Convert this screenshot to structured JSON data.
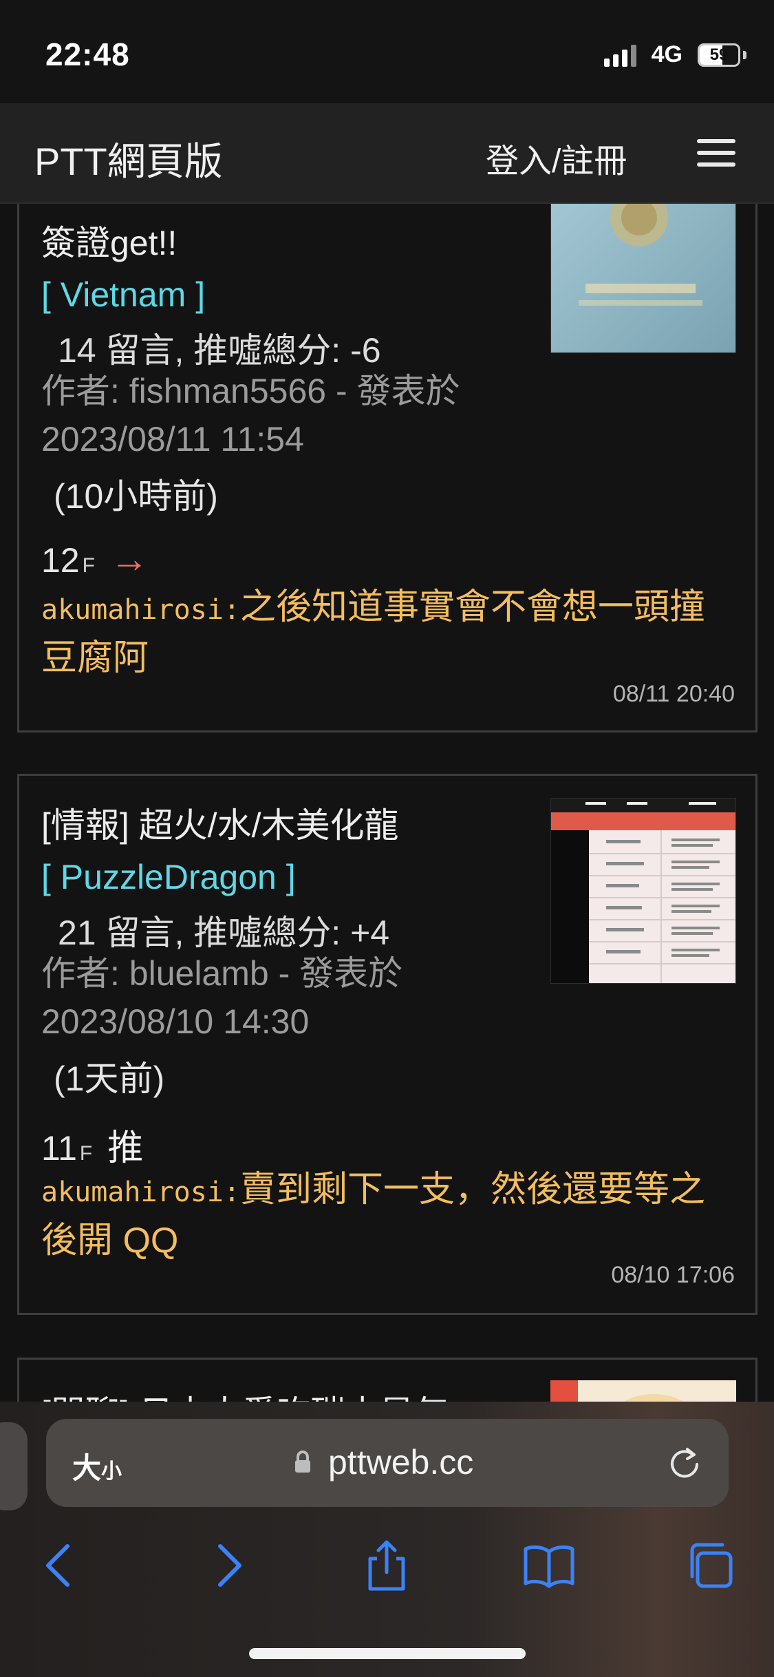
{
  "status": {
    "time": "22:48",
    "network": "4G",
    "battery": "59",
    "battery_level": 0.59
  },
  "navbar": {
    "brand": "PTT網頁版",
    "login_label": "登入/註冊",
    "menu_icon": "hamburger-menu-icon"
  },
  "posts": [
    {
      "title_line2": "簽證get!!",
      "board": "[ Vietnam ]",
      "stats": "14 留言, 推噓總分: -6",
      "author_line": "作者: fishman5566 - 發表於 2023/08/11 11:54",
      "ago": "(10小時前)",
      "floor": "12",
      "floor_suffix": "F",
      "reaction": "→",
      "comment_user": "akumahirosi:",
      "comment_text": "之後知道事實會不會想一頭撞豆腐阿",
      "comment_time": "08/11 20:40"
    },
    {
      "title": "[情報] 超火/水/木美化龍",
      "board": "[ PuzzleDragon ]",
      "stats": "21 留言, 推噓總分: +4",
      "author_line": "作者: bluelamb - 發表於 2023/08/10 14:30",
      "ago": "(1天前)",
      "floor": "11",
      "floor_suffix": "F",
      "reaction": "推",
      "comment_user": "akumahirosi:",
      "comment_text": "賣到剩下一支，然後還要等之後開 QQ",
      "comment_time": "08/10 17:06"
    },
    {
      "title": "[閒聊] 日本人愛吃碳水是怎"
    }
  ],
  "browser": {
    "text_size_label": "大",
    "text_size_small": "小",
    "url": "pttweb.cc",
    "toolbar": [
      "back-icon",
      "forward-icon",
      "share-icon",
      "bookmarks-icon",
      "tabs-icon"
    ]
  },
  "colors": {
    "board_tag": "#5fd7e6",
    "comment": "#f3bd5e",
    "arrow": "#ef6c66",
    "ios_blue": "#3b82f6"
  }
}
